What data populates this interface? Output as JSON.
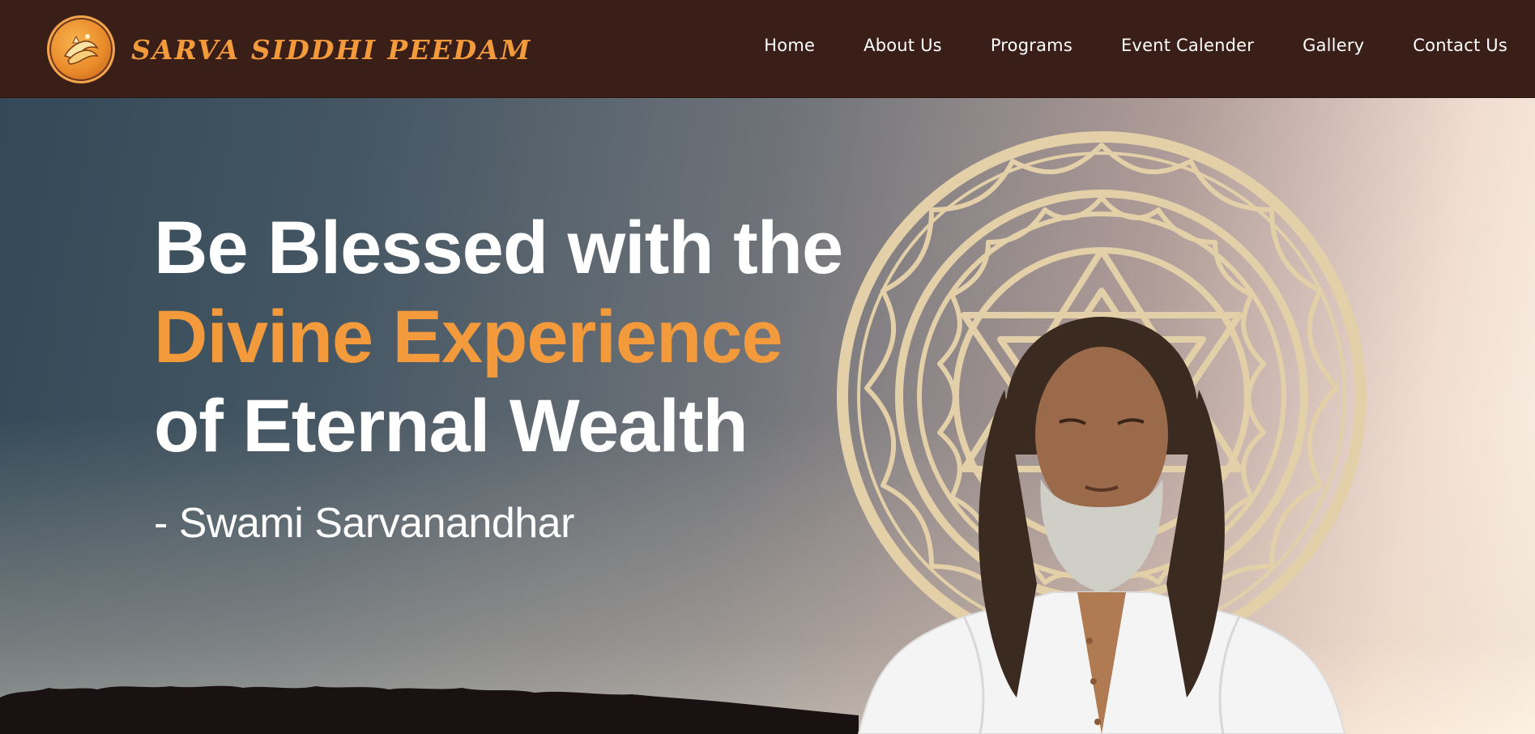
{
  "brand": {
    "name": "SARVA SIDDHI PEEDAM",
    "logo_icon": "praying-hands-logo-icon"
  },
  "nav": {
    "items": [
      "Home",
      "About Us",
      "Programs",
      "Event Calender",
      "Gallery",
      "Contact Us"
    ]
  },
  "hero": {
    "line1": "Be Blessed with the",
    "line2": "Divine Experience",
    "line3": "of Eternal Wealth",
    "attribution": "- Swami Sarvanandhar"
  },
  "colors": {
    "header_bg": "#3a1e18",
    "accent": "#f39a3d",
    "text": "#ffffff"
  }
}
